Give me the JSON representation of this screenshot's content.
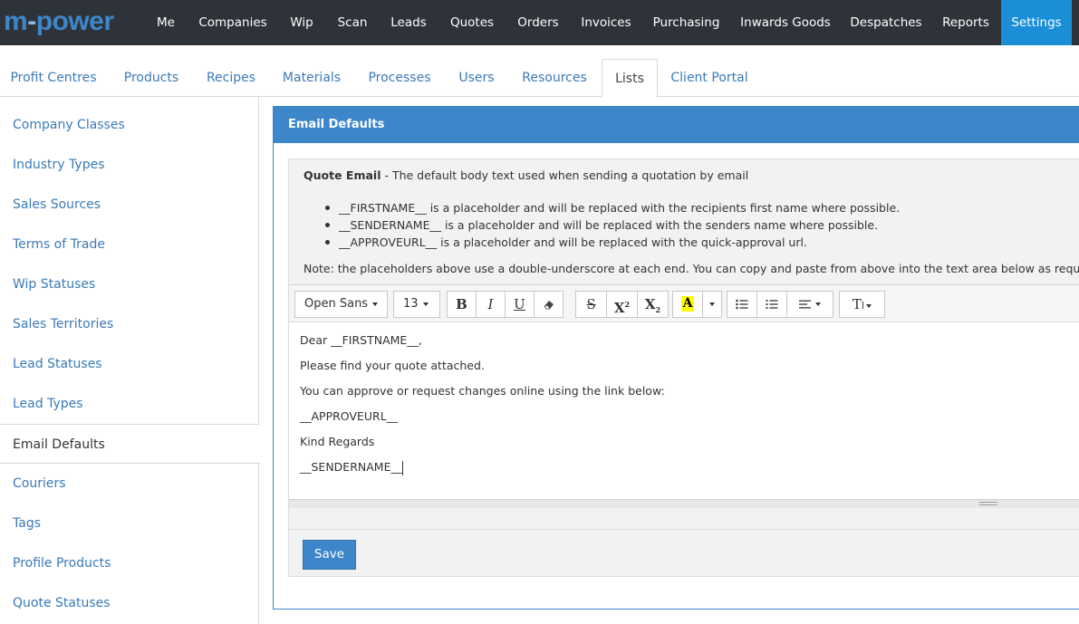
{
  "brand": {
    "m": "m",
    "dot": "-",
    "rest": "power"
  },
  "topnav": [
    {
      "label": "Me"
    },
    {
      "label": "Companies"
    },
    {
      "label": "Wip"
    },
    {
      "label": "Scan"
    },
    {
      "label": "Leads"
    },
    {
      "label": "Quotes"
    },
    {
      "label": "Orders"
    },
    {
      "label": "Invoices"
    },
    {
      "label": "Purchasing"
    },
    {
      "label": "Inwards Goods"
    },
    {
      "label": "Despatches"
    },
    {
      "label": "Reports"
    },
    {
      "label": "Settings"
    }
  ],
  "topnav_active": "Settings",
  "subtabs": [
    {
      "label": "Profit Centres"
    },
    {
      "label": "Products"
    },
    {
      "label": "Recipes"
    },
    {
      "label": "Materials"
    },
    {
      "label": "Processes"
    },
    {
      "label": "Users"
    },
    {
      "label": "Resources"
    },
    {
      "label": "Lists"
    },
    {
      "label": "Client Portal"
    }
  ],
  "subtab_active": "Lists",
  "sidebar": [
    {
      "label": "Company Classes"
    },
    {
      "label": "Industry Types"
    },
    {
      "label": "Sales Sources"
    },
    {
      "label": "Terms of Trade"
    },
    {
      "label": "Wip Statuses"
    },
    {
      "label": "Sales Territories"
    },
    {
      "label": "Lead Statuses"
    },
    {
      "label": "Lead Types"
    },
    {
      "label": "Email Defaults"
    },
    {
      "label": "Couriers"
    },
    {
      "label": "Tags"
    },
    {
      "label": "Profile Products"
    },
    {
      "label": "Quote Statuses"
    }
  ],
  "sidebar_active": "Email Defaults",
  "panel": {
    "title": "Email Defaults",
    "intro_bold": "Quote Email",
    "intro_rest": " - The default body text used when sending a quotation by email",
    "bullets": [
      "__FIRSTNAME__ is a placeholder and will be replaced with the recipients first name where possible.",
      "__SENDERNAME__ is a placeholder and will be replaced with the senders name where possible.",
      "__APPROVEURL__ is a placeholder and will be replaced with the quick-approval url."
    ],
    "note": "Note: the placeholders above use a double-underscore at each end. You can copy and paste from above into the text area below as required."
  },
  "editor": {
    "font_family": "Open Sans",
    "font_size": "13",
    "highlight_letter": "A",
    "text_size_icon": "T",
    "body": [
      "Dear __FIRSTNAME__,",
      "Please find your quote attached.",
      "You can approve or request changes online using the link below:",
      "__APPROVEURL__",
      "Kind Regards",
      "__SENDERNAME__"
    ]
  },
  "save_label": "Save",
  "colors": {
    "nav_bg": "#2d3339",
    "nav_active": "#1a8fd8",
    "accent": "#3d86c9",
    "link": "#3a7ab8"
  }
}
